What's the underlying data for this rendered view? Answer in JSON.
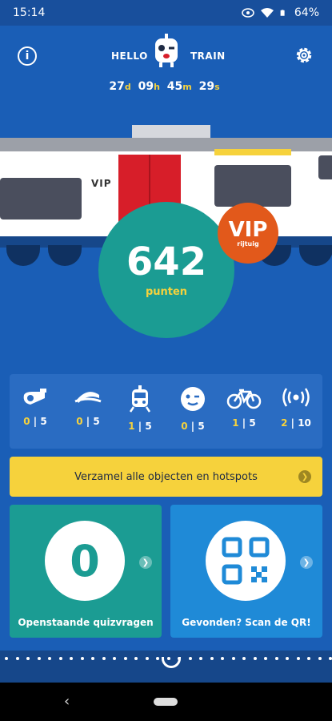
{
  "status": {
    "time": "15:14",
    "battery": "64%"
  },
  "header": {
    "hello": "HELLO",
    "train": "TRAIN",
    "countdown": [
      {
        "value": "27",
        "unit": "d"
      },
      {
        "value": "09",
        "unit": "h"
      },
      {
        "value": "45",
        "unit": "m"
      },
      {
        "value": "29",
        "unit": "s"
      }
    ]
  },
  "train": {
    "label": "VIP"
  },
  "score": {
    "points": "642",
    "label": "punten"
  },
  "vip": {
    "title": "VIP",
    "subtitle": "rijtuig"
  },
  "objects": [
    {
      "icon": "whistle-icon",
      "found": "0",
      "total": "5"
    },
    {
      "icon": "conductor-cap-icon",
      "found": "0",
      "total": "5"
    },
    {
      "icon": "train-icon",
      "found": "1",
      "total": "5"
    },
    {
      "icon": "winking-face-icon",
      "found": "0",
      "total": "5"
    },
    {
      "icon": "bicycle-icon",
      "found": "1",
      "total": "5"
    },
    {
      "icon": "wifi-hotspot-icon",
      "found": "2",
      "total": "10"
    }
  ],
  "collect_button": "Verzamel alle objecten en hotspots",
  "quiz": {
    "count": "0",
    "label": "Openstaande quizvragen"
  },
  "scan": {
    "label": "Gevonden? Scan de QR!"
  },
  "colors": {
    "background": "#1a5eb6",
    "accent": "#f6d23c",
    "teal": "#1b9c93",
    "vip": "#e2591b"
  }
}
